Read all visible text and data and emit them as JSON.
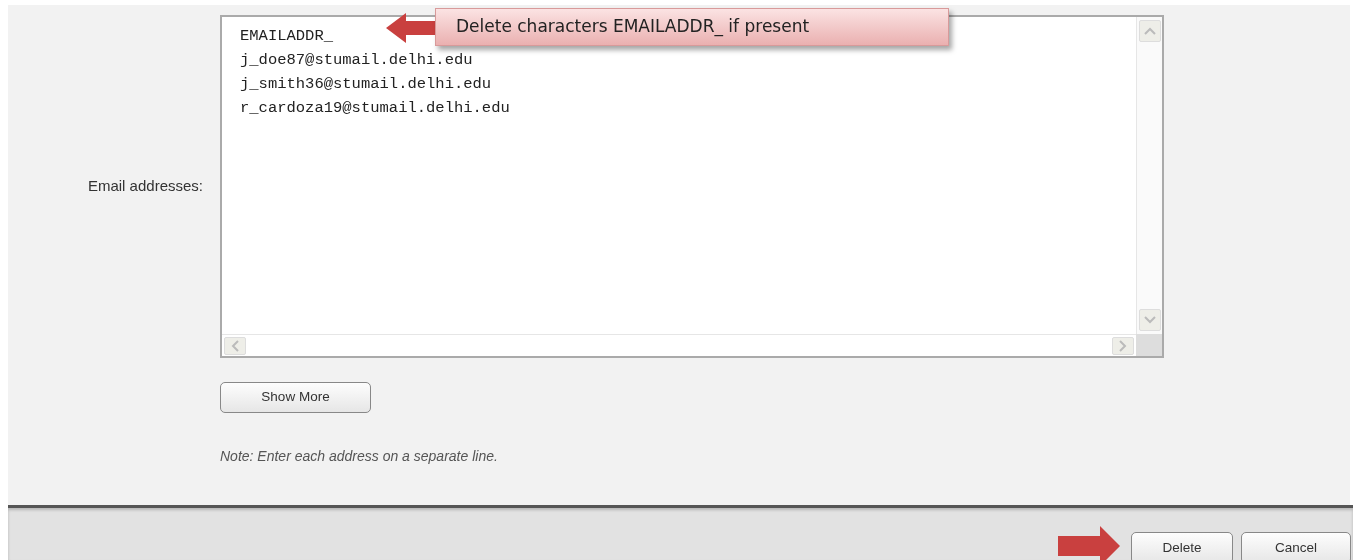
{
  "form": {
    "label": "Email addresses:",
    "emails": [
      "EMAILADDR_",
      "j_doe87@stumail.delhi.edu",
      "j_smith36@stumail.delhi.edu",
      "r_cardoza19@stumail.delhi.edu"
    ],
    "callout": "Delete characters EMAILADDR_ if present",
    "show_more": "Show More",
    "note": "Note: Enter each address on a separate line."
  },
  "footer": {
    "buttons": [
      {
        "label": "Delete"
      },
      {
        "label": "Cancel"
      }
    ]
  }
}
